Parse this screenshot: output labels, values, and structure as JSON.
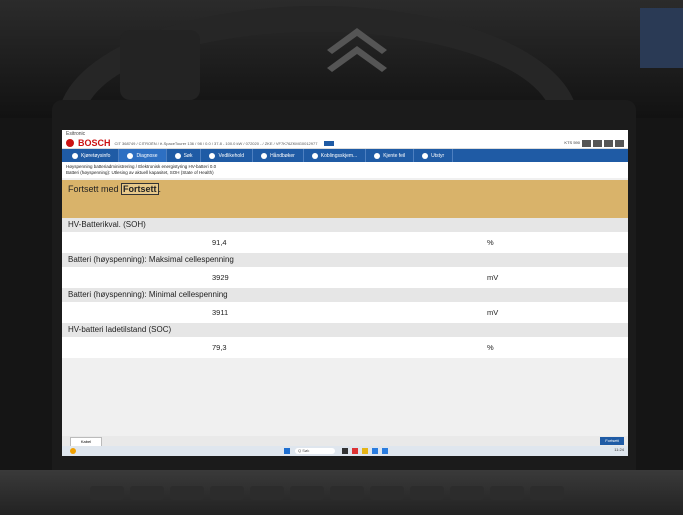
{
  "window": {
    "title": "Esitronic",
    "brand": "BOSCH",
    "path": "CIT 368749 / CITROËN / ë-SpaceTourer 136 / 98 / 0.0 / 37.8 - 100.0 kW / 072020 - / ZKE / VF7K76ZKMG0012977"
  },
  "nav": {
    "items": [
      {
        "label": "Kjøretøysinfo"
      },
      {
        "label": "Diagnose"
      },
      {
        "label": "Søk"
      },
      {
        "label": "Vedlikehold"
      },
      {
        "label": "Håndbøker"
      },
      {
        "label": "Koblingsskjem..."
      },
      {
        "label": "Kjente feil"
      },
      {
        "label": "Utstyr"
      }
    ],
    "user": "KTS 590"
  },
  "breadcrumb": {
    "line1": "Høyspenning batteriadministrering / Elektronisk energistyring HV-batteri 0.0",
    "line2": "Batteri (høyspenning): Utlesing av aktuell kapasitet, SOH (State of Health)"
  },
  "instruction": {
    "prefix": "Fortsett med",
    "keyword": "Fortsett",
    "suffix": "."
  },
  "values": [
    {
      "label": "HV-Batterikval. (SOH)",
      "value": "91,4",
      "unit": "%"
    },
    {
      "label": "Batteri (høyspenning): Maksimal cellespenning",
      "value": "3929",
      "unit": "mV"
    },
    {
      "label": "Batteri (høyspenning): Minimal cellespenning",
      "value": "3911",
      "unit": "mV"
    },
    {
      "label": "HV-batteri ladetilstand (SOC)",
      "value": "79,3",
      "unit": "%"
    }
  ],
  "footer": {
    "tab_label": "Kabel",
    "continue_label": "Fortsett"
  },
  "taskbar": {
    "search_placeholder": "Q Søk",
    "time": "11:24"
  },
  "colors": {
    "nav_blue": "#1f5ba5",
    "instruction_bg": "#d9b36a",
    "brand_red": "#cc1111"
  }
}
